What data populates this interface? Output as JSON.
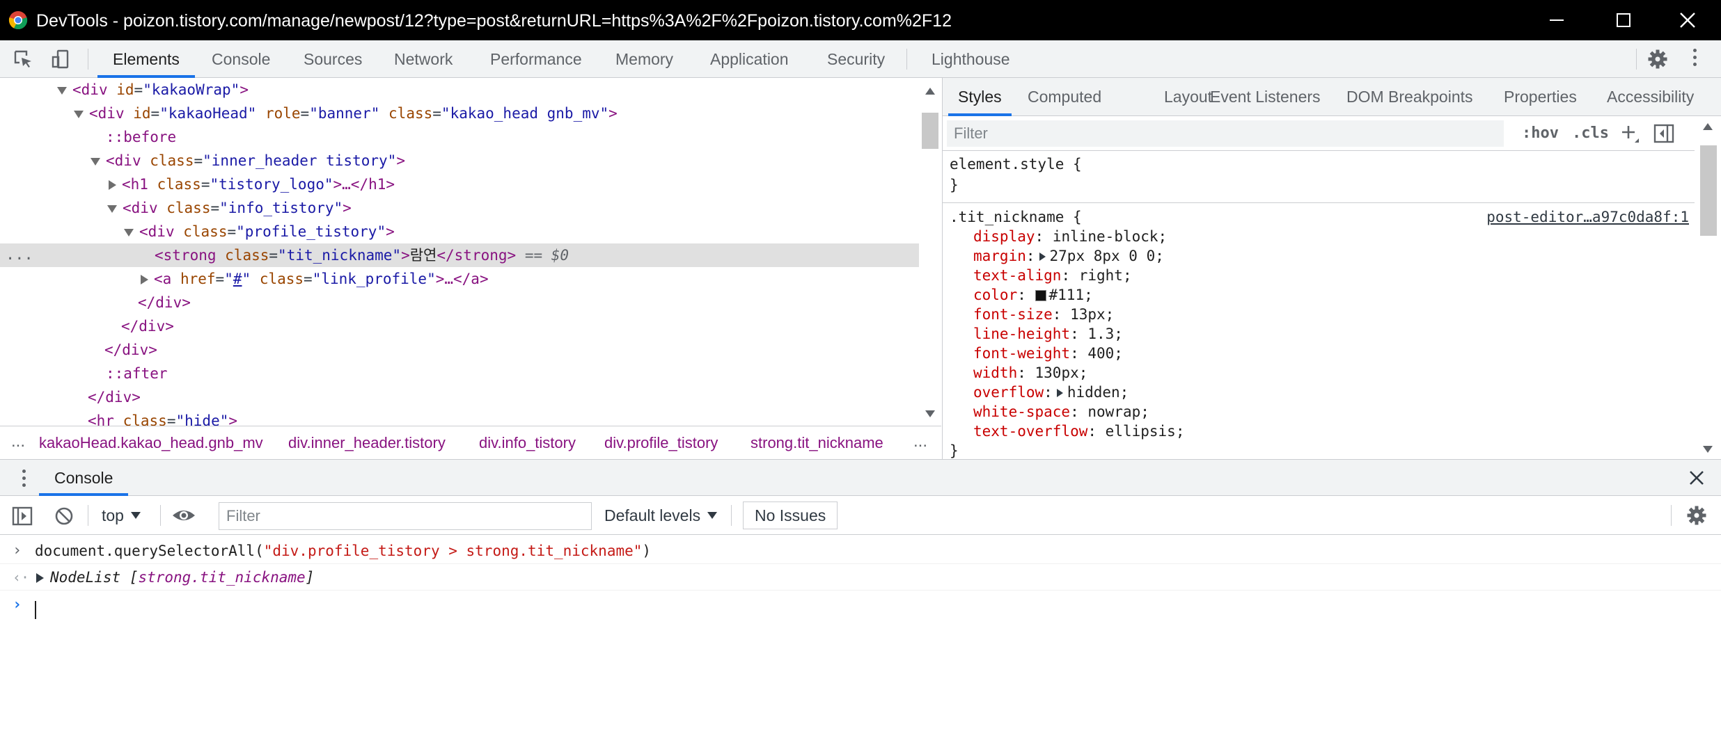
{
  "window": {
    "title": "DevTools - poizon.tistory.com/manage/newpost/12?type=post&returnURL=https%3A%2F%2Fpoizon.tistory.com%2F12"
  },
  "main_tabs": [
    "Elements",
    "Console",
    "Sources",
    "Network",
    "Performance",
    "Memory",
    "Application",
    "Security",
    "Lighthouse"
  ],
  "active_main_tab": "Elements",
  "dom": {
    "lines": [
      {
        "open": "<",
        "tag": "div",
        "attrs": [
          {
            "name": "id",
            "value": "kakaoWrap"
          }
        ],
        "close": ">"
      },
      {
        "open": "<",
        "tag": "div",
        "attrs": [
          {
            "name": "id",
            "value": "kakaoHead"
          },
          {
            "name": "role",
            "value": "banner"
          },
          {
            "name": "class",
            "value": "kakao_head gnb_mv"
          }
        ],
        "close": ">"
      },
      {
        "pseudo": "::before"
      },
      {
        "open": "<",
        "tag": "div",
        "attrs": [
          {
            "name": "class",
            "value": "inner_header tistory"
          }
        ],
        "close": ">"
      },
      {
        "open": "<",
        "tag": "h1",
        "attrs": [
          {
            "name": "class",
            "value": "tistory_logo"
          }
        ],
        "close": ">…</h1>"
      },
      {
        "open": "<",
        "tag": "div",
        "attrs": [
          {
            "name": "class",
            "value": "info_tistory"
          }
        ],
        "close": ">"
      },
      {
        "open": "<",
        "tag": "div",
        "attrs": [
          {
            "name": "class",
            "value": "profile_tistory"
          }
        ],
        "close": ">"
      },
      {
        "open": "<",
        "tag": "strong",
        "attrs": [
          {
            "name": "class",
            "value": "tit_nickname"
          }
        ],
        "text": "람연",
        "end": "</strong>",
        "eq": "== $0"
      },
      {
        "open": "<",
        "tag": "a",
        "attrs": [
          {
            "name": "href",
            "value": "#"
          },
          {
            "name": "class",
            "value": "link_profile"
          }
        ],
        "close": ">…</a>"
      },
      {
        "closing": "</div>"
      },
      {
        "closing": "</div>"
      },
      {
        "closing": "</div>"
      },
      {
        "pseudo": "::after"
      },
      {
        "closing": "</div>"
      },
      {
        "open": "<",
        "tag": "hr",
        "attrs": [
          {
            "name": "class",
            "value": "hide"
          }
        ],
        "close": ">"
      }
    ],
    "row_dots": "..."
  },
  "breadcrumb": {
    "more": "...",
    "items": [
      "kakaoHead.kakao_head.gnb_mv",
      "div.inner_header.tistory",
      "div.info_tistory",
      "div.profile_tistory",
      "strong.tit_nickname"
    ],
    "trailing_more": "..."
  },
  "styles": {
    "tabs": [
      "Styles",
      "Computed",
      "Layout",
      "Event Listeners",
      "DOM Breakpoints",
      "Properties",
      "Accessibility"
    ],
    "active_tab": "Styles",
    "filter_placeholder": "Filter",
    "hov": ":hov",
    "cls": ".cls",
    "element_style": {
      "selector": "element.style {",
      "close": "}"
    },
    "rule": {
      "selector": ".tit_nickname {",
      "source": "post-editor…a97c0da8f:1",
      "declarations": [
        {
          "prop": "display",
          "value": "inline-block;"
        },
        {
          "prop": "margin",
          "value": "27px 8px 0 0;",
          "expandable": true
        },
        {
          "prop": "text-align",
          "value": "right;"
        },
        {
          "prop": "color",
          "value": "#111;",
          "swatch": "#111111"
        },
        {
          "prop": "font-size",
          "value": "13px;"
        },
        {
          "prop": "line-height",
          "value": "1.3;"
        },
        {
          "prop": "font-weight",
          "value": "400;"
        },
        {
          "prop": "width",
          "value": "130px;"
        },
        {
          "prop": "overflow",
          "value": "hidden;",
          "expandable": true
        },
        {
          "prop": "white-space",
          "value": "nowrap;"
        },
        {
          "prop": "text-overflow",
          "value": "ellipsis;"
        }
      ],
      "close": "}"
    }
  },
  "drawer": {
    "tab": "Console",
    "toolbar": {
      "context": "top",
      "filter_placeholder": "Filter",
      "levels": "Default levels",
      "issues": "No Issues"
    },
    "console": {
      "input_prefix": "document.querySelectorAll(",
      "input_string": "\"div.profile_tistory > strong.tit_nickname\"",
      "input_suffix": ")",
      "result_type": "NodeList",
      "result_open": "[",
      "result_item": "strong.tit_nickname",
      "result_close": "]"
    }
  },
  "colors": {
    "accent": "#1a73e8",
    "tag": "#881280",
    "attr_name": "#994500",
    "attr_value": "#1a1aa6",
    "css_prop": "#c80000",
    "console_string": "#c41a16"
  },
  "icons": [
    "chrome-logo-icon",
    "minimize-icon",
    "maximize-icon",
    "close-icon",
    "inspect-element-icon",
    "device-toolbar-icon",
    "settings-icon",
    "new-style-rule-icon",
    "toggle-sidebar-icon",
    "sidebar-toggle-icon",
    "clear-console-icon",
    "live-expression-icon",
    "drawer-close-icon",
    "prompt-chevron-icon"
  ]
}
